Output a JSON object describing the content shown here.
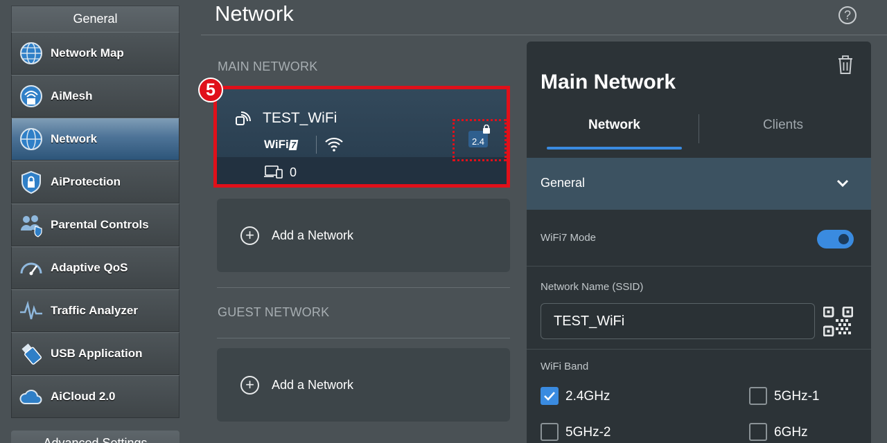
{
  "sidebar": {
    "header": "General",
    "items": [
      {
        "label": "Network Map",
        "icon": "globe-icon"
      },
      {
        "label": "AiMesh",
        "icon": "aimesh-icon"
      },
      {
        "label": "Network",
        "icon": "network-globe-icon",
        "active": true
      },
      {
        "label": "AiProtection",
        "icon": "shield-lock-icon"
      },
      {
        "label": "Parental Controls",
        "icon": "family-icon"
      },
      {
        "label": "Adaptive QoS",
        "icon": "gauge-icon"
      },
      {
        "label": "Traffic Analyzer",
        "icon": "pulse-icon"
      },
      {
        "label": "USB Application",
        "icon": "usb-icon"
      },
      {
        "label": "AiCloud 2.0",
        "icon": "cloud-icon"
      }
    ],
    "advanced_label": "Advanced Settings"
  },
  "header": {
    "title": "Network",
    "help_icon": "?"
  },
  "main_network": {
    "section_label": "MAIN NETWORK",
    "card": {
      "ssid": "TEST_WiFi",
      "wifi_badge": "WiFi",
      "wifi_gen": "7",
      "band": "2.4",
      "client_count": "0"
    },
    "annotation_number": "5",
    "add_label": "Add a Network"
  },
  "guest_network": {
    "section_label": "GUEST NETWORK",
    "add_label": "Add a Network"
  },
  "panel": {
    "title": "Main Network",
    "tabs": [
      {
        "label": "Network",
        "active": true
      },
      {
        "label": "Clients"
      }
    ],
    "general_label": "General",
    "wifi7_mode_label": "WiFi7 Mode",
    "wifi7_mode_on": true,
    "ssid_label": "Network Name (SSID)",
    "ssid_value": "TEST_WiFi",
    "band_label": "WiFi Band",
    "bands": [
      {
        "label": "2.4GHz",
        "checked": true
      },
      {
        "label": "5GHz-1",
        "checked": false
      },
      {
        "label": "5GHz-2",
        "checked": false
      },
      {
        "label": "6GHz",
        "checked": false
      }
    ]
  },
  "colors": {
    "accent": "#3a8be0",
    "highlight": "#e0101a",
    "active_nav": "#4d7397"
  }
}
